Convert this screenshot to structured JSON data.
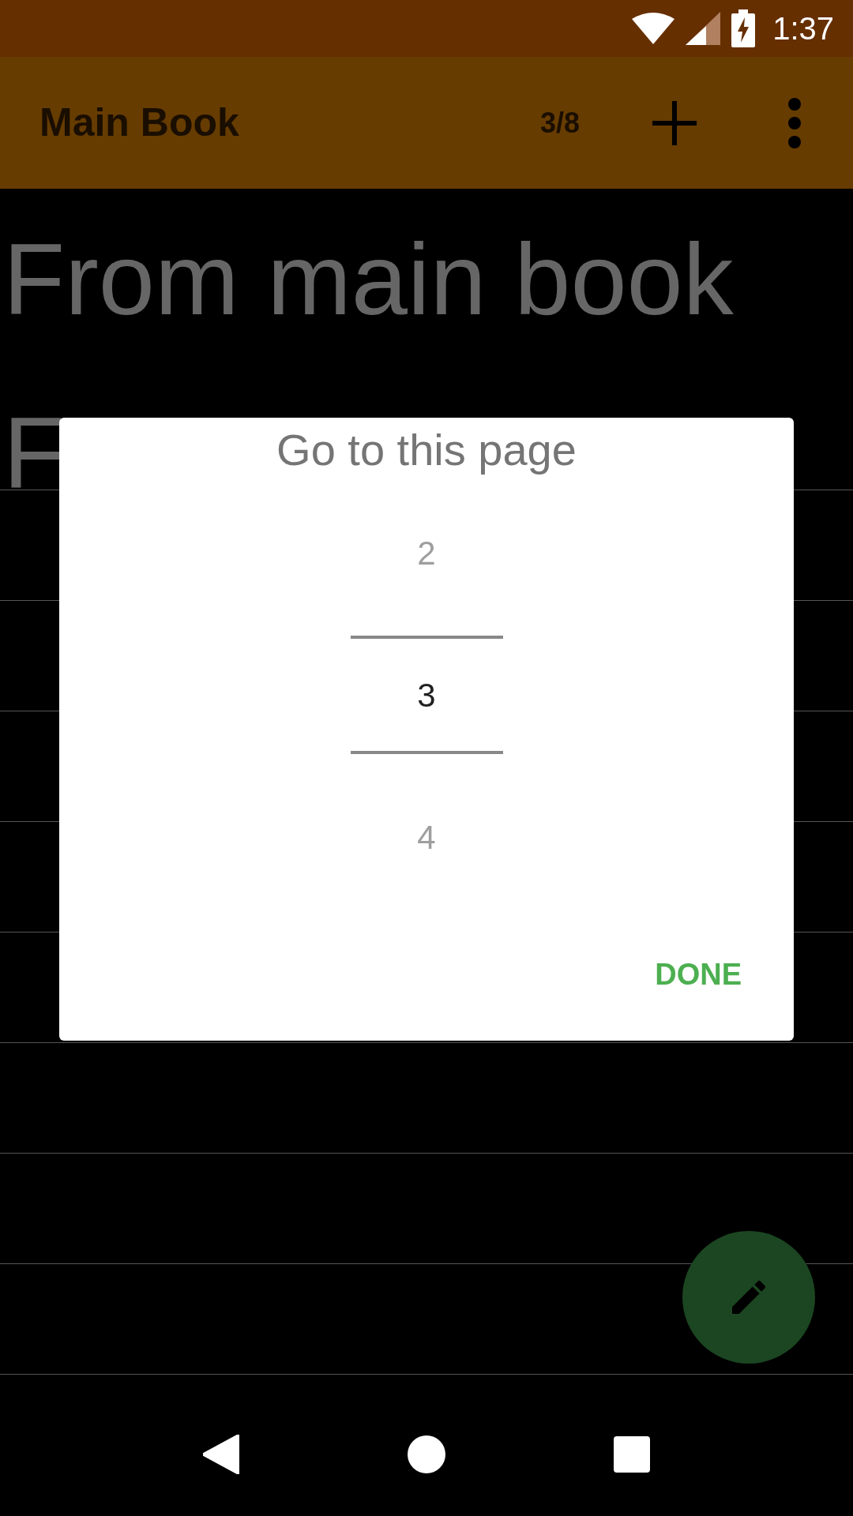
{
  "status_bar": {
    "time": "1:37"
  },
  "app_bar": {
    "title": "Main Book",
    "page_indicator": "3/8"
  },
  "page": {
    "lines": [
      "From main book",
      "F"
    ]
  },
  "dialog": {
    "title": "Go to this page",
    "picker": [
      {
        "value": "2",
        "selected": false
      },
      {
        "value": "3",
        "selected": true
      },
      {
        "value": "4",
        "selected": false
      }
    ],
    "button": "DONE"
  }
}
